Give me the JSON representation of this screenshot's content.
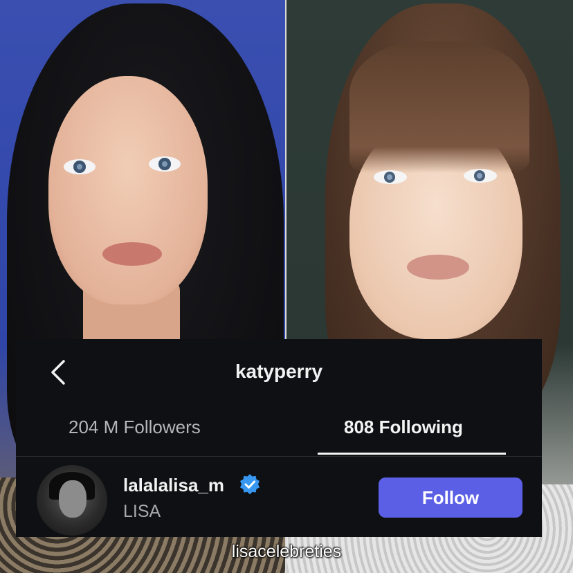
{
  "profile": {
    "username": "katyperry"
  },
  "tabs": {
    "followers": "204 M Followers",
    "following": "808 Following"
  },
  "account": {
    "handle": "lalalalisa_m",
    "display_name": "LISA",
    "follow_label": "Follow"
  },
  "watermark": "lisacelebreties",
  "colors": {
    "card_bg": "#0e1013",
    "follow_button": "#5b5fe6",
    "verified": "#3897f0"
  },
  "icons": {
    "back": "chevron-left-icon",
    "verified": "verified-badge-icon"
  }
}
